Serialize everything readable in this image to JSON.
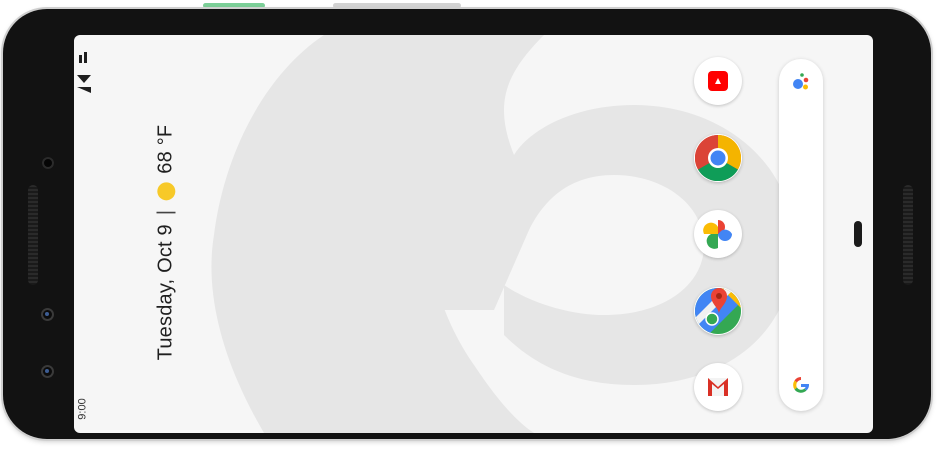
{
  "device": {
    "model_mark": "3",
    "hardware_colors": {
      "frame": "#121212",
      "power_button": "#7ccf98",
      "volume_button": "#d3d3d3"
    }
  },
  "status_bar": {
    "time": "9:00",
    "icons": [
      "wifi-icon",
      "cell-signal-icon"
    ]
  },
  "at_a_glance": {
    "date": "Tuesday, Oct 9",
    "separator": "|",
    "weather_icon": "sun-icon",
    "temperature": "68 °F"
  },
  "dock": {
    "apps": [
      {
        "name": "YouTube",
        "icon": "youtube-icon"
      },
      {
        "name": "Chrome",
        "icon": "chrome-icon"
      },
      {
        "name": "Photos",
        "icon": "photos-icon"
      },
      {
        "name": "Maps",
        "icon": "maps-icon"
      },
      {
        "name": "Gmail",
        "icon": "gmail-icon"
      }
    ]
  },
  "search_bar": {
    "icons": [
      "google-assistant-icon",
      "google-g-icon"
    ]
  },
  "colors": {
    "google_blue": "#4285F4",
    "google_red": "#EA4335",
    "google_yellow": "#FBBC05",
    "google_green": "#34A853"
  }
}
